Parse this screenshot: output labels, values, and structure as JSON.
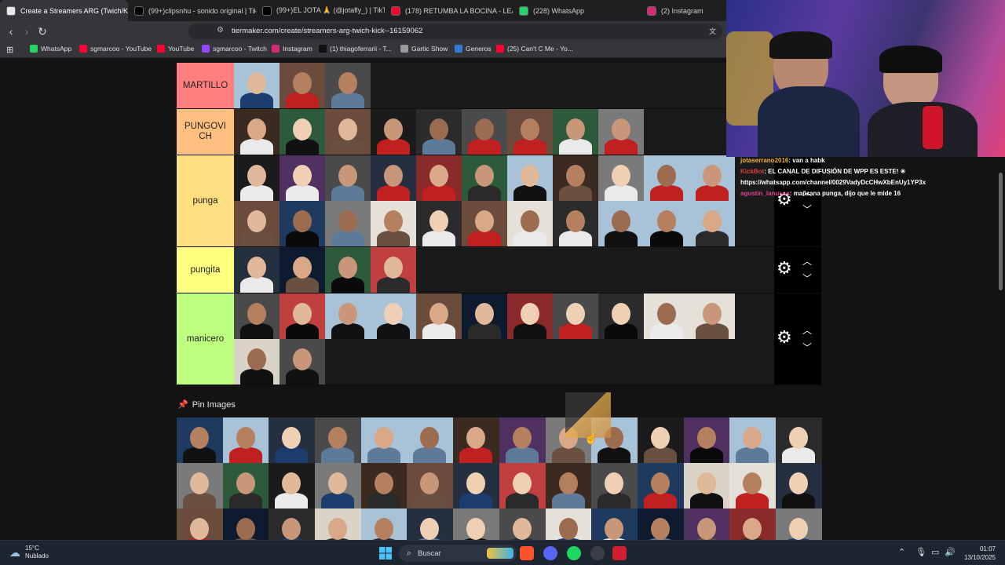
{
  "browser": {
    "tabs": [
      {
        "label": "Create a Streamers ARG (Twich/Ki",
        "icon": "tiermaker-icon",
        "color": "#e8e8e8",
        "active": true
      },
      {
        "label": "(99+)clipsnhu - sonido original | TikT",
        "icon": "tiktok-icon",
        "color": "#000000"
      },
      {
        "label": "(99+)EL JOTA 🙏 (@jotafly_) | TikTok",
        "icon": "tiktok-icon",
        "color": "#000000"
      },
      {
        "label": "(178) RETUMBA LA BOCINA - LEA",
        "icon": "youtube-icon",
        "color": "#ff0033"
      },
      {
        "label": "(228) WhatsApp",
        "icon": "whatsapp-icon",
        "color": "#25d366"
      },
      {
        "label": "(2) Instagram",
        "icon": "instagram-icon",
        "color": "#d62976"
      }
    ],
    "url": "tiermaker.com/create/streamers-arg-twich-kick--16159062",
    "bookmarks": [
      {
        "label": "WhatsApp",
        "color": "#25d366"
      },
      {
        "label": "sgmarcoo - YouTube",
        "color": "#ff0033"
      },
      {
        "label": "YouTube",
        "color": "#ff0033"
      },
      {
        "label": "sgmarcoo - Twitch",
        "color": "#9146ff"
      },
      {
        "label": "Instagram",
        "color": "#d62976"
      },
      {
        "label": "(1) thiagoferrarii - T...",
        "color": "#111111"
      },
      {
        "label": "Gartic Show",
        "color": "#999999"
      },
      {
        "label": "Generos",
        "color": "#2f7bd8"
      },
      {
        "label": "(25) Can't C Me - Yo...",
        "color": "#ff0033"
      }
    ]
  },
  "tierlist": {
    "tiers": [
      {
        "label": "MARTILLO",
        "color": "#ff7f7f",
        "items": 3
      },
      {
        "label": "PUNGOVICH",
        "color": "#ffbf7f",
        "items": 9
      },
      {
        "label": "punga",
        "color": "#ffdf7f",
        "items": 22
      },
      {
        "label": "pungita",
        "color": "#ffff7f",
        "items": 4
      },
      {
        "label": "manicero",
        "color": "#bfff7f",
        "items": 13
      }
    ],
    "pin_header": "Pin Images",
    "pool_count": 42
  },
  "chat": [
    {
      "user": "jotaserrano2016",
      "text": ": van a habk",
      "role": "u1"
    },
    {
      "user": "KickBot",
      "text": ": EL CANAL DE DIFUSIÓN DE WPP ES ESTE! ✳",
      "role": "u2"
    },
    {
      "user": "",
      "text": "https://whatsapp.com/channel/0029VadyDcCHwXbEnUy1YP3x",
      "role": ""
    },
    {
      "user": "agustin_lanusse",
      "text": ": mañzana punga, dijo que le mide 16",
      "role": "u3"
    }
  ],
  "taskbar": {
    "temperature": "15°C",
    "weather": "Nublado",
    "search": "Buscar",
    "time": "01:07",
    "date": "13/10/2025"
  }
}
